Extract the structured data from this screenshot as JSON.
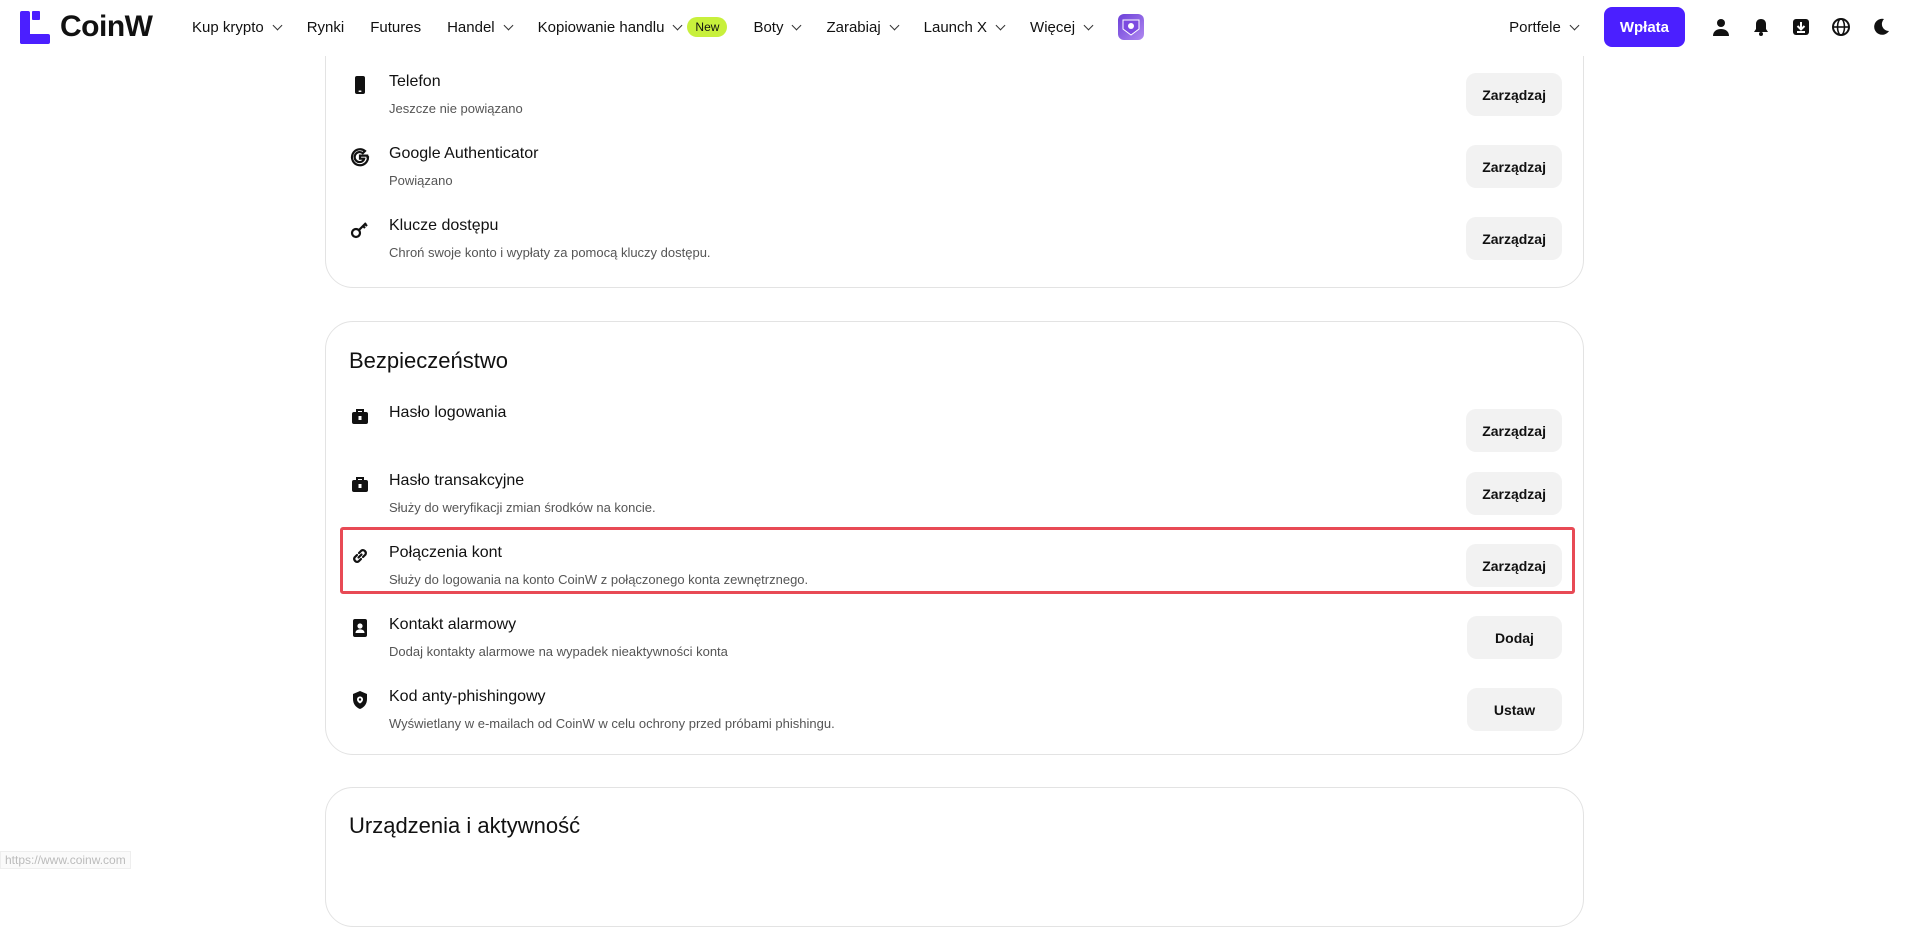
{
  "nav": {
    "logo_text": "CoinW",
    "items": [
      {
        "label": "Kup krypto",
        "dropdown": true
      },
      {
        "label": "Rynki",
        "dropdown": false
      },
      {
        "label": "Futures",
        "dropdown": false
      },
      {
        "label": "Handel",
        "dropdown": true
      },
      {
        "label": "Kopiowanie handlu",
        "dropdown": true,
        "badge": "New"
      },
      {
        "label": "Boty",
        "dropdown": true
      },
      {
        "label": "Zarabiaj",
        "dropdown": true
      },
      {
        "label": "Launch X",
        "dropdown": true
      },
      {
        "label": "Więcej",
        "dropdown": true
      }
    ],
    "portfele_label": "Portfele",
    "deposit_label": "Wpłata",
    "brand_color": "#4b1fff",
    "badge_color": "#c8f03c"
  },
  "card1": {
    "rows": [
      {
        "title": "Telefon",
        "desc": "Jeszcze nie powiązano",
        "button": "Zarządzaj",
        "icon": "phone-icon"
      },
      {
        "title": "Google Authenticator",
        "desc": "Powiązano",
        "button": "Zarządzaj",
        "icon": "google-icon"
      },
      {
        "title": "Klucze dostępu",
        "desc": "Chroń swoje konto i wypłaty za pomocą kluczy dostępu.",
        "button": "Zarządzaj",
        "icon": "key-icon"
      }
    ]
  },
  "security": {
    "title": "Bezpieczeństwo",
    "rows": [
      {
        "title": "Hasło logowania",
        "desc": "",
        "button": "Zarządzaj",
        "icon": "lock-briefcase-icon"
      },
      {
        "title": "Hasło transakcyjne",
        "desc": "Służy do weryfikacji zmian środków na koncie.",
        "button": "Zarządzaj",
        "icon": "lock-briefcase-icon"
      },
      {
        "title": "Połączenia kont",
        "desc": "Służy do logowania na konto CoinW z połączonego konta zewnętrznego.",
        "button": "Zarządzaj",
        "icon": "link-icon"
      },
      {
        "title": "Kontakt alarmowy",
        "desc": "Dodaj kontakty alarmowe na wypadek nieaktywności konta",
        "button": "Dodaj",
        "icon": "contact-book-icon"
      },
      {
        "title": "Kod anty-phishingowy",
        "desc": "Wyświetlany w e-mailach od CoinW w celu ochrony przed próbami phishingu.",
        "button": "Ustaw",
        "icon": "shield-icon"
      }
    ]
  },
  "devices": {
    "title": "Urządzenia i aktywność"
  },
  "status_url": "https://www.coinw.com",
  "highlight_color": "#e84a55"
}
